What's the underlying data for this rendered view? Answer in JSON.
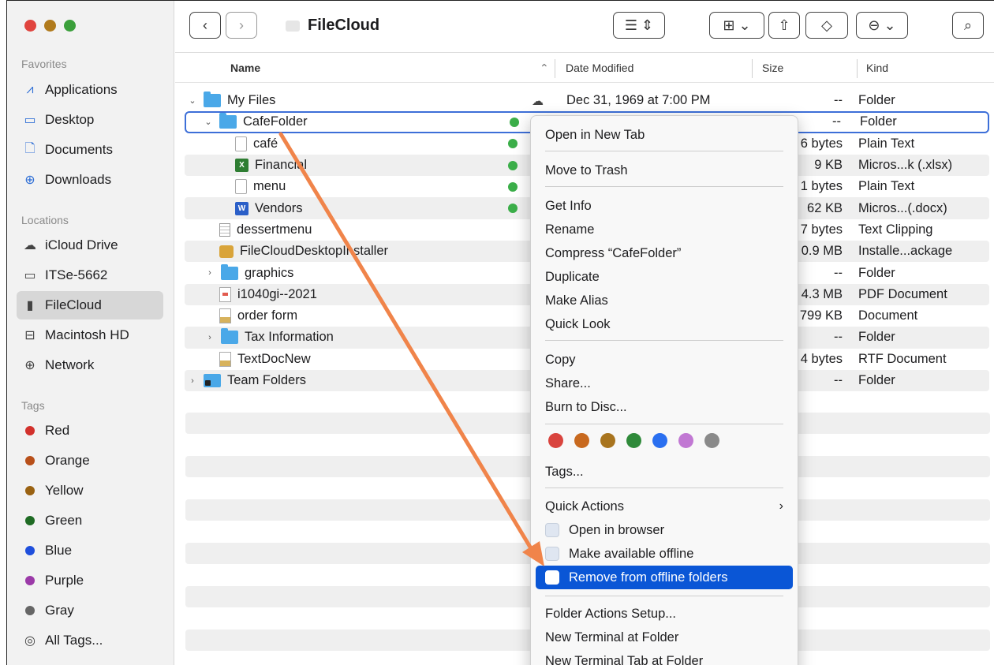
{
  "window": {
    "title": "FileCloud"
  },
  "sidebar": {
    "favorites_label": "Favorites",
    "favorites": [
      {
        "label": "Applications",
        "icon": "applications-icon"
      },
      {
        "label": "Desktop",
        "icon": "desktop-icon"
      },
      {
        "label": "Documents",
        "icon": "documents-icon"
      },
      {
        "label": "Downloads",
        "icon": "downloads-icon"
      }
    ],
    "locations_label": "Locations",
    "locations": [
      {
        "label": "iCloud Drive",
        "icon": "icloud-icon"
      },
      {
        "label": "ITSe-5662",
        "icon": "computer-icon"
      },
      {
        "label": "FileCloud",
        "icon": "filecloud-icon",
        "selected": true
      },
      {
        "label": "Macintosh HD",
        "icon": "drive-icon"
      },
      {
        "label": "Network",
        "icon": "network-icon"
      }
    ],
    "tags_label": "Tags",
    "tags": [
      {
        "label": "Red",
        "color": "#d2312c"
      },
      {
        "label": "Orange",
        "color": "#b8501a"
      },
      {
        "label": "Yellow",
        "color": "#9a6212"
      },
      {
        "label": "Green",
        "color": "#1f6b24"
      },
      {
        "label": "Blue",
        "color": "#1f4fdc"
      },
      {
        "label": "Purple",
        "color": "#9b3aa8"
      },
      {
        "label": "Gray",
        "color": "#666666"
      },
      {
        "label": "All Tags...",
        "color": ""
      }
    ]
  },
  "columns": {
    "name": "Name",
    "date": "Date Modified",
    "size": "Size",
    "kind": "Kind"
  },
  "files": [
    {
      "name": "My Files",
      "date": "Dec 31, 1969 at 7:00 PM",
      "size": "--",
      "kind": "Folder"
    },
    {
      "name": "CafeFolder",
      "date": "",
      "size": "--",
      "kind": "Folder"
    },
    {
      "name": "café",
      "date": "",
      "size": "6 bytes",
      "kind": "Plain Text"
    },
    {
      "name": "Financial",
      "date": "",
      "size": "9 KB",
      "kind": "Micros...k (.xlsx)"
    },
    {
      "name": "menu",
      "date": "",
      "size": "1 bytes",
      "kind": "Plain Text"
    },
    {
      "name": "Vendors",
      "date": "",
      "size": "62 KB",
      "kind": "Micros...(.docx)"
    },
    {
      "name": "dessertmenu",
      "date": "",
      "size": "7 bytes",
      "kind": "Text Clipping"
    },
    {
      "name": "FileCloudDesktopInstaller",
      "date": "",
      "size": "0.9 MB",
      "kind": "Installe...ackage"
    },
    {
      "name": "graphics",
      "date": "",
      "size": "--",
      "kind": "Folder"
    },
    {
      "name": "i1040gi--2021",
      "date": "",
      "size": "4.3 MB",
      "kind": "PDF Document"
    },
    {
      "name": "order form",
      "date": "",
      "size": "799 KB",
      "kind": "Document"
    },
    {
      "name": "Tax Information",
      "date": "",
      "size": "--",
      "kind": "Folder"
    },
    {
      "name": "TextDocNew",
      "date": "",
      "size": "4 bytes",
      "kind": "RTF Document"
    },
    {
      "name": "Team Folders",
      "date": "",
      "size": "--",
      "kind": "Folder"
    }
  ],
  "context_menu": {
    "items": [
      "Open in New Tab",
      "Move to Trash",
      "Get Info",
      "Rename",
      "Compress “CafeFolder”",
      "Duplicate",
      "Make Alias",
      "Quick Look",
      "Copy",
      "Share...",
      "Burn to Disc...",
      "Tags...",
      "Quick Actions",
      "Open in browser",
      "Make available offline",
      "Remove from offline folders",
      "Folder Actions Setup...",
      "New Terminal at Folder",
      "New Terminal Tab at Folder"
    ],
    "tag_colors": [
      "#d9443e",
      "#c8691f",
      "#a8741e",
      "#2f8a3a",
      "#2a6ff0",
      "#c178d3",
      "#8a8a8a"
    ],
    "highlight_color": "#0a56d6"
  },
  "annotation": {
    "arrow_color": "#f0844a"
  }
}
